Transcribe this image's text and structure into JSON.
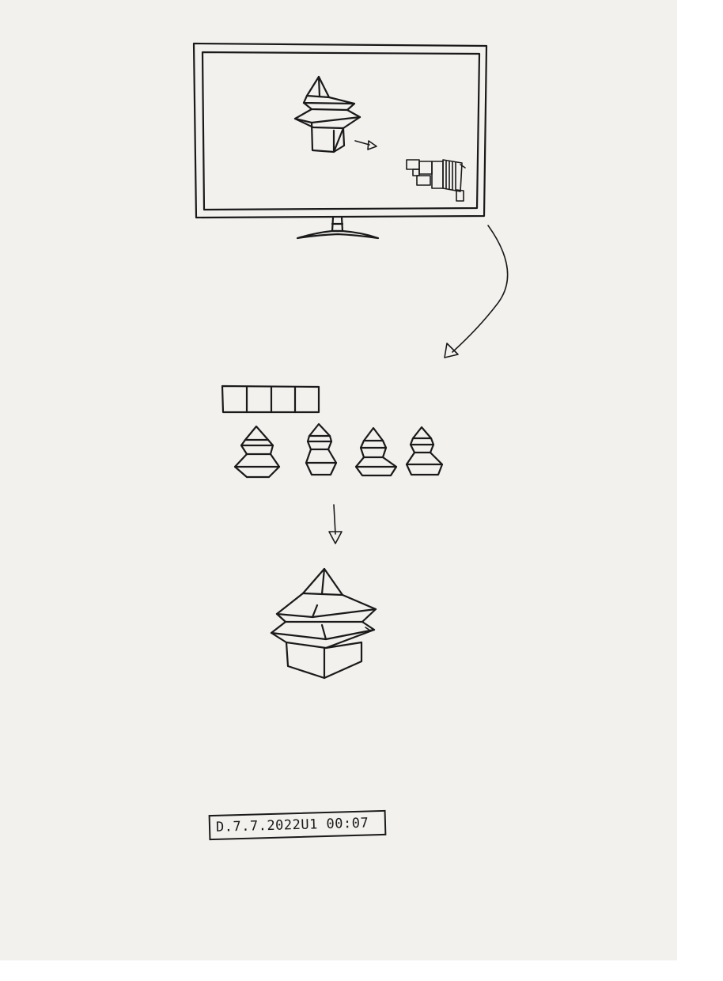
{
  "colors": {
    "paper": "#f3f1ee",
    "ink": "#1a1a1a"
  },
  "monitor": {
    "icons": [
      "pagoda-icon",
      "arrow-right-icon",
      "block-cluster-icon"
    ]
  },
  "pipeline": {
    "bar_segments": 4,
    "pagoda_variants": 4
  },
  "date_label": "D.7.7.2022U1 00:07"
}
